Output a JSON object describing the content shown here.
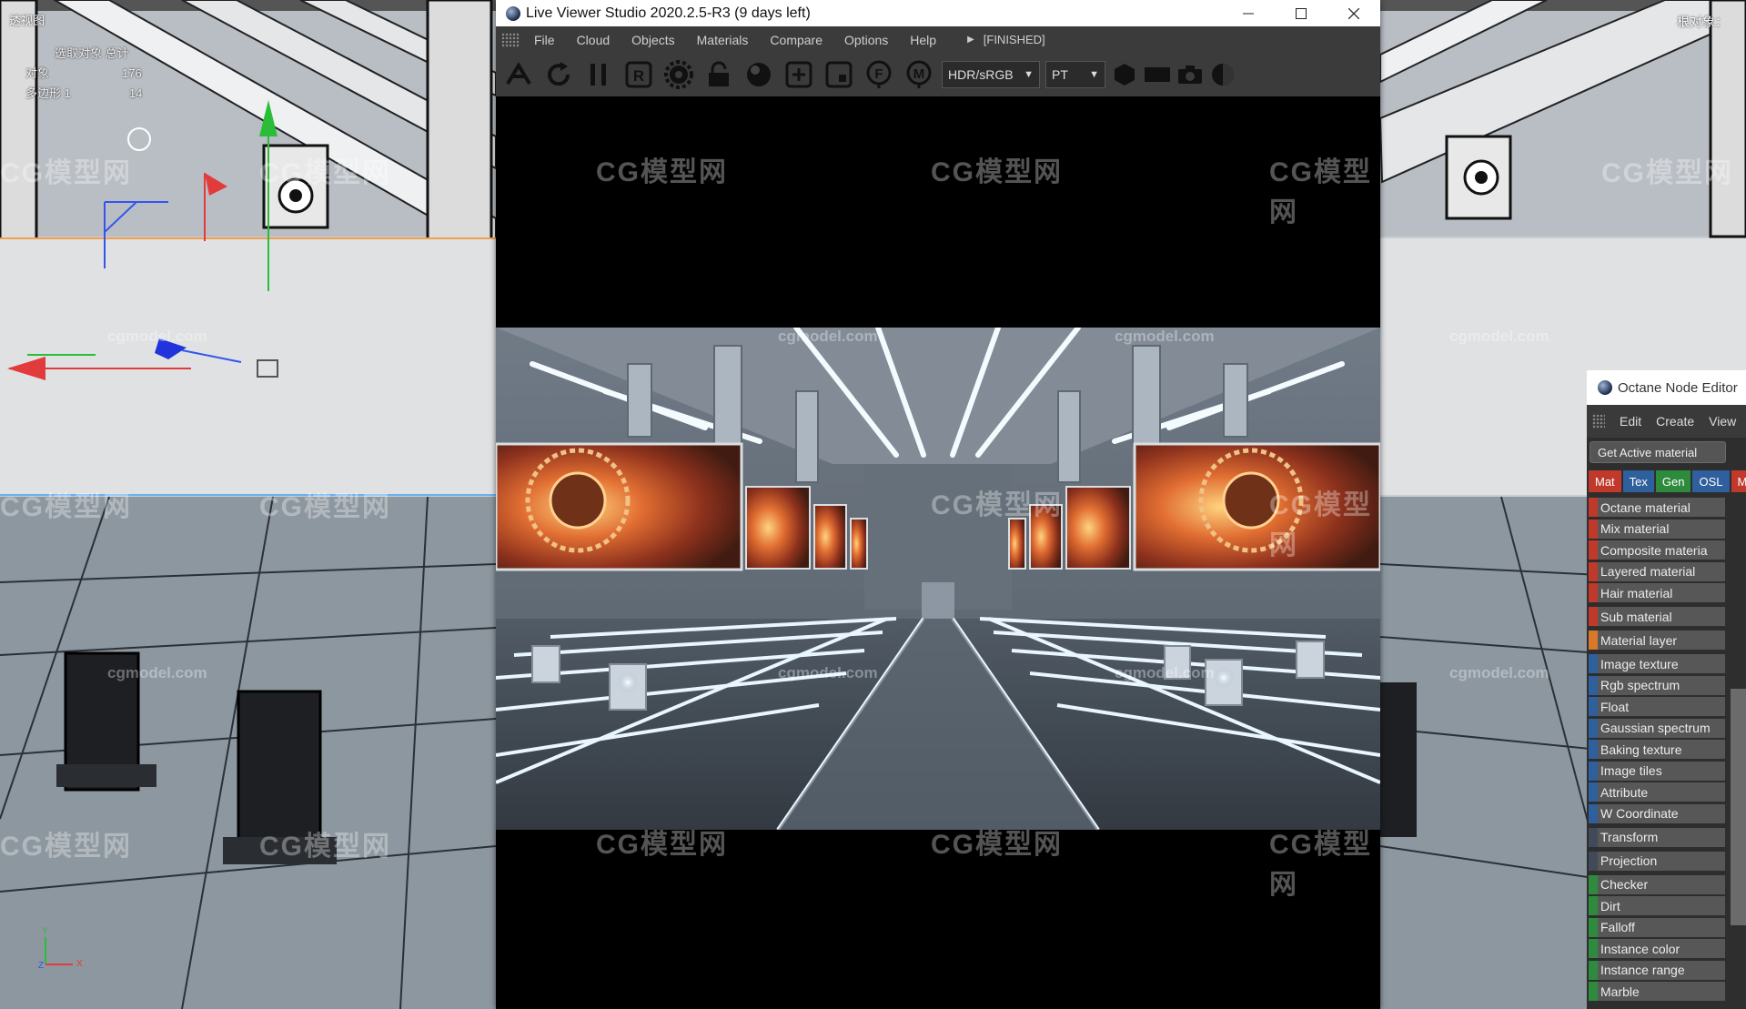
{
  "viewport": {
    "top_left_label": "透视图",
    "top_right_label": "根对象：",
    "stats": {
      "header": "选取对象 总计",
      "rows": [
        {
          "label": "对象",
          "value": "176"
        },
        {
          "label": "多边形 1",
          "value": "14"
        }
      ]
    },
    "axis_x": "X",
    "axis_y": "Y",
    "axis_z": "Z"
  },
  "watermarks": {
    "brand": "CG模型网",
    "domain": "cgmodel.com"
  },
  "live_viewer": {
    "title": "Live Viewer Studio 2020.2.5-R3 (9 days left)",
    "menu": [
      "File",
      "Cloud",
      "Objects",
      "Materials",
      "Compare",
      "Options",
      "Help"
    ],
    "status": "[FINISHED]",
    "toolbar_letters": {
      "r": "R",
      "f": "F",
      "m": "M"
    },
    "color_mode": "HDR/sRGB",
    "kernel": "PT"
  },
  "node_editor": {
    "title": "Octane Node Editor",
    "menu": [
      "Edit",
      "Create",
      "View"
    ],
    "get_button": "Get Active material",
    "tabs": [
      {
        "label": "Mat",
        "color": "#c0392b"
      },
      {
        "label": "Tex",
        "color": "#2f5f9c"
      },
      {
        "label": "Gen",
        "color": "#2e8b3d"
      },
      {
        "label": "OSL",
        "color": "#2f5f9c"
      },
      {
        "label": "M",
        "color": "#c0392b"
      }
    ],
    "items": [
      {
        "label": "Octane material",
        "color": "#c0392b"
      },
      {
        "label": "Mix material",
        "color": "#c0392b"
      },
      {
        "label": "Composite materia",
        "color": "#c0392b"
      },
      {
        "label": "Layered material",
        "color": "#c0392b"
      },
      {
        "label": "Hair material",
        "color": "#c0392b"
      },
      {
        "label": "Sub material",
        "color": "#c0392b"
      },
      {
        "label": "Material layer",
        "color": "#d8782a"
      },
      {
        "label": "Image texture",
        "color": "#2f5f9c"
      },
      {
        "label": "Rgb spectrum",
        "color": "#2f5f9c"
      },
      {
        "label": "Float",
        "color": "#2f5f9c"
      },
      {
        "label": "Gaussian spectrum",
        "color": "#2f5f9c"
      },
      {
        "label": "Baking texture",
        "color": "#2f5f9c"
      },
      {
        "label": "Image tiles",
        "color": "#2f5f9c"
      },
      {
        "label": "Attribute",
        "color": "#2f5f9c"
      },
      {
        "label": "W Coordinate",
        "color": "#2f5f9c"
      },
      {
        "label": "Transform",
        "color": "#404a5a"
      },
      {
        "label": "Projection",
        "color": "#404a5a"
      },
      {
        "label": "Checker",
        "color": "#2e8b3d"
      },
      {
        "label": "Dirt",
        "color": "#2e8b3d"
      },
      {
        "label": "Falloff",
        "color": "#2e8b3d"
      },
      {
        "label": "Instance color",
        "color": "#2e8b3d"
      },
      {
        "label": "Instance range",
        "color": "#2e8b3d"
      },
      {
        "label": "Marble",
        "color": "#2e8b3d"
      }
    ]
  }
}
